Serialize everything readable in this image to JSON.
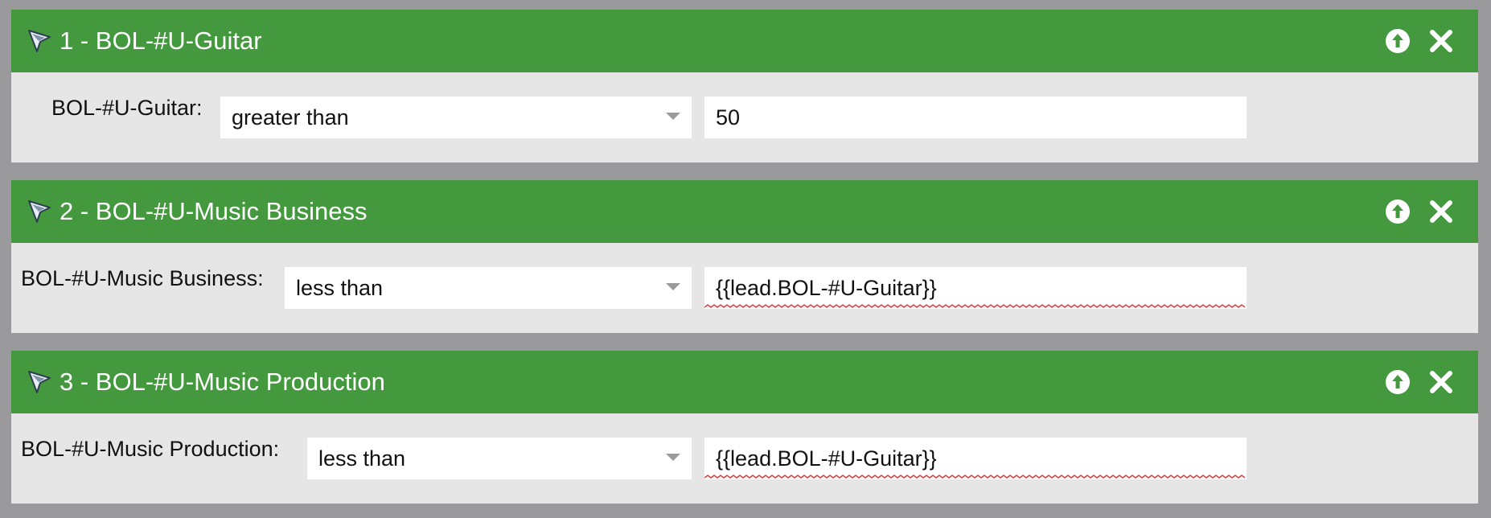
{
  "colors": {
    "header_green": "#44993e",
    "body_gray": "#e6e6e6",
    "page_gray": "#9a9a9c",
    "spellcheck_red": "#e23b3b"
  },
  "filters": [
    {
      "title": "1 - BOL-#U-Guitar",
      "field_label": "BOL-#U-Guitar:",
      "operator": "greater than",
      "value": "50",
      "spellcheck_flag": false,
      "icons": [
        "filter-funnel-icon",
        "move-up-icon",
        "close-icon"
      ]
    },
    {
      "title": "2 - BOL-#U-Music Business",
      "field_label": "BOL-#U-Music Business:",
      "operator": "less than",
      "value": "{{lead.BOL-#U-Guitar}}",
      "spellcheck_flag": true,
      "icons": [
        "filter-funnel-icon",
        "move-up-icon",
        "close-icon"
      ]
    },
    {
      "title": "3 - BOL-#U-Music Production",
      "field_label": "BOL-#U-Music Production:",
      "operator": "less than",
      "value": "{{lead.BOL-#U-Guitar}}",
      "spellcheck_flag": true,
      "icons": [
        "filter-funnel-icon",
        "move-up-icon",
        "close-icon"
      ]
    }
  ]
}
